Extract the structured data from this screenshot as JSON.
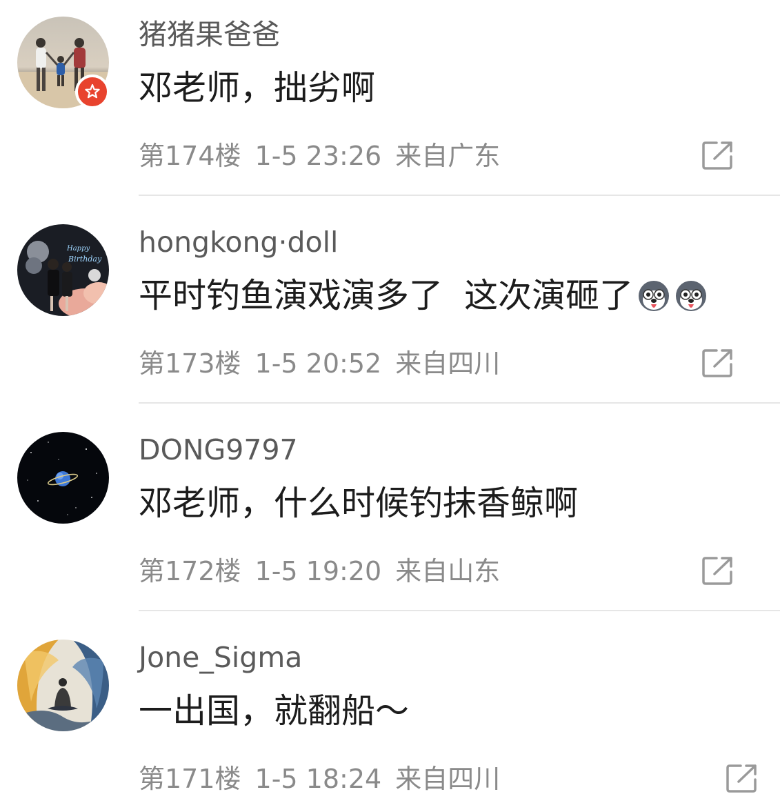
{
  "comments": [
    {
      "username": "猪猪果爸爸",
      "text": "邓老师，拙劣啊",
      "floor": "第174楼",
      "time": "1-5 23:26",
      "location": "来自广东",
      "avatar_icon": "beach-family-avatar",
      "badge_icon": "star-badge-icon",
      "emojis": []
    },
    {
      "username": "hongkong·doll",
      "text": "平时钓鱼演戏演多了  这次演砸了",
      "floor": "第173楼",
      "time": "1-5 20:52",
      "location": "来自四川",
      "avatar_icon": "birthday-party-avatar",
      "emojis": [
        "husky-emoji-icon",
        "husky-emoji-icon"
      ]
    },
    {
      "username": "DONG9797",
      "text": "邓老师，什么时候钓抹香鲸啊",
      "floor": "第172楼",
      "time": "1-5 19:20",
      "location": "来自山东",
      "avatar_icon": "planet-space-avatar",
      "emojis": []
    },
    {
      "username": "Jone_Sigma",
      "text": "一出国，就翻船～",
      "floor": "第171楼",
      "time": "1-5 18:24",
      "location": "来自四川",
      "avatar_icon": "ink-wave-avatar",
      "emojis": []
    }
  ],
  "colors": {
    "username": "#5a5a5a",
    "content": "#1c1c1c",
    "meta": "#8a8a8a",
    "divider": "#e6e6e6",
    "badge": "#e8432e"
  }
}
